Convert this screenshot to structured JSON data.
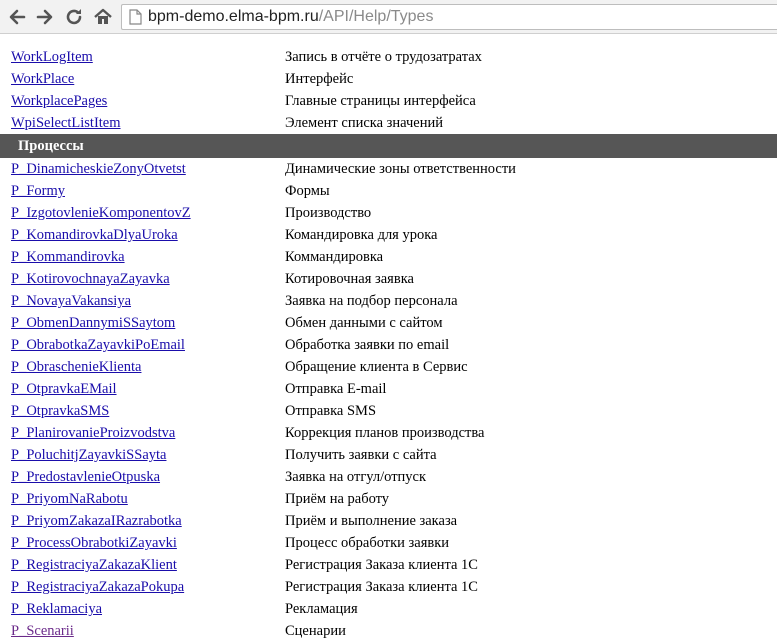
{
  "browser": {
    "url_host": "bpm-demo.elma-bpm.ru",
    "url_path": "/API/Help/Types",
    "icons": [
      "back-icon",
      "forward-icon",
      "reload-icon",
      "home-icon",
      "page-icon"
    ]
  },
  "rows_top": [
    {
      "name": "WorkLogItem",
      "desc": "Запись в отчёте о трудозатратах"
    },
    {
      "name": "WorkPlace",
      "desc": "Интерфейс"
    },
    {
      "name": "WorkplacePages",
      "desc": "Главные страницы интерфейса"
    },
    {
      "name": "WpiSelectListItem",
      "desc": "Элемент списка значений"
    }
  ],
  "section_title": "Процессы",
  "rows_processes": [
    {
      "name": "P_DinamicheskieZonyOtvetst",
      "desc": "Динамические зоны ответственности"
    },
    {
      "name": "P_Formy",
      "desc": "Формы"
    },
    {
      "name": "P_IzgotovlenieKomponentovZ",
      "desc": "Производство"
    },
    {
      "name": "P_KomandirovkaDlyaUroka",
      "desc": "Командировка для урока"
    },
    {
      "name": "P_Kommandirovka",
      "desc": "Коммандировка"
    },
    {
      "name": "P_KotirovochnayaZayavka",
      "desc": "Котировочная заявка"
    },
    {
      "name": "P_NovayaVakansiya",
      "desc": "Заявка на подбор персонала"
    },
    {
      "name": "P_ObmenDannymiSSaytom",
      "desc": "Обмен данными с сайтом"
    },
    {
      "name": "P_ObrabotkaZayavkiPoEmail",
      "desc": "Обработка заявки по email"
    },
    {
      "name": "P_ObraschenieKlienta",
      "desc": "Обращение клиента в Сервис"
    },
    {
      "name": "P_OtpravkaEMail",
      "desc": "Отправка E-mail"
    },
    {
      "name": "P_OtpravkaSMS",
      "desc": "Отправка SMS"
    },
    {
      "name": "P_PlanirovanieProizvodstva",
      "desc": "Коррекция планов производства"
    },
    {
      "name": "P_PoluchitjZayavkiSSayta",
      "desc": "Получить заявки с сайта"
    },
    {
      "name": "P_PredostavlenieOtpuska",
      "desc": "Заявка на отгул/отпуск"
    },
    {
      "name": "P_PriyomNaRabotu",
      "desc": "Приём на работу"
    },
    {
      "name": "P_PriyomZakazaIRazrabotka",
      "desc": "Приём и выполнение заказа"
    },
    {
      "name": "P_ProcessObrabotkiZayavki",
      "desc": "Процесс обработки заявки"
    },
    {
      "name": "P_RegistraciyaZakazaKlient",
      "desc": "Регистрация Заказа клиента 1С"
    },
    {
      "name": "P_RegistraciyaZakazaPokupa",
      "desc": "Регистрация Заказа клиента 1С"
    },
    {
      "name": "P_Reklamaciya",
      "desc": "Рекламация"
    },
    {
      "name": "P_Scenarii",
      "desc": "Сценарии",
      "visited": true
    }
  ],
  "colors": {
    "link": "#1a0dab",
    "visited_link": "#6b2a8a",
    "section_bg": "#565656"
  }
}
